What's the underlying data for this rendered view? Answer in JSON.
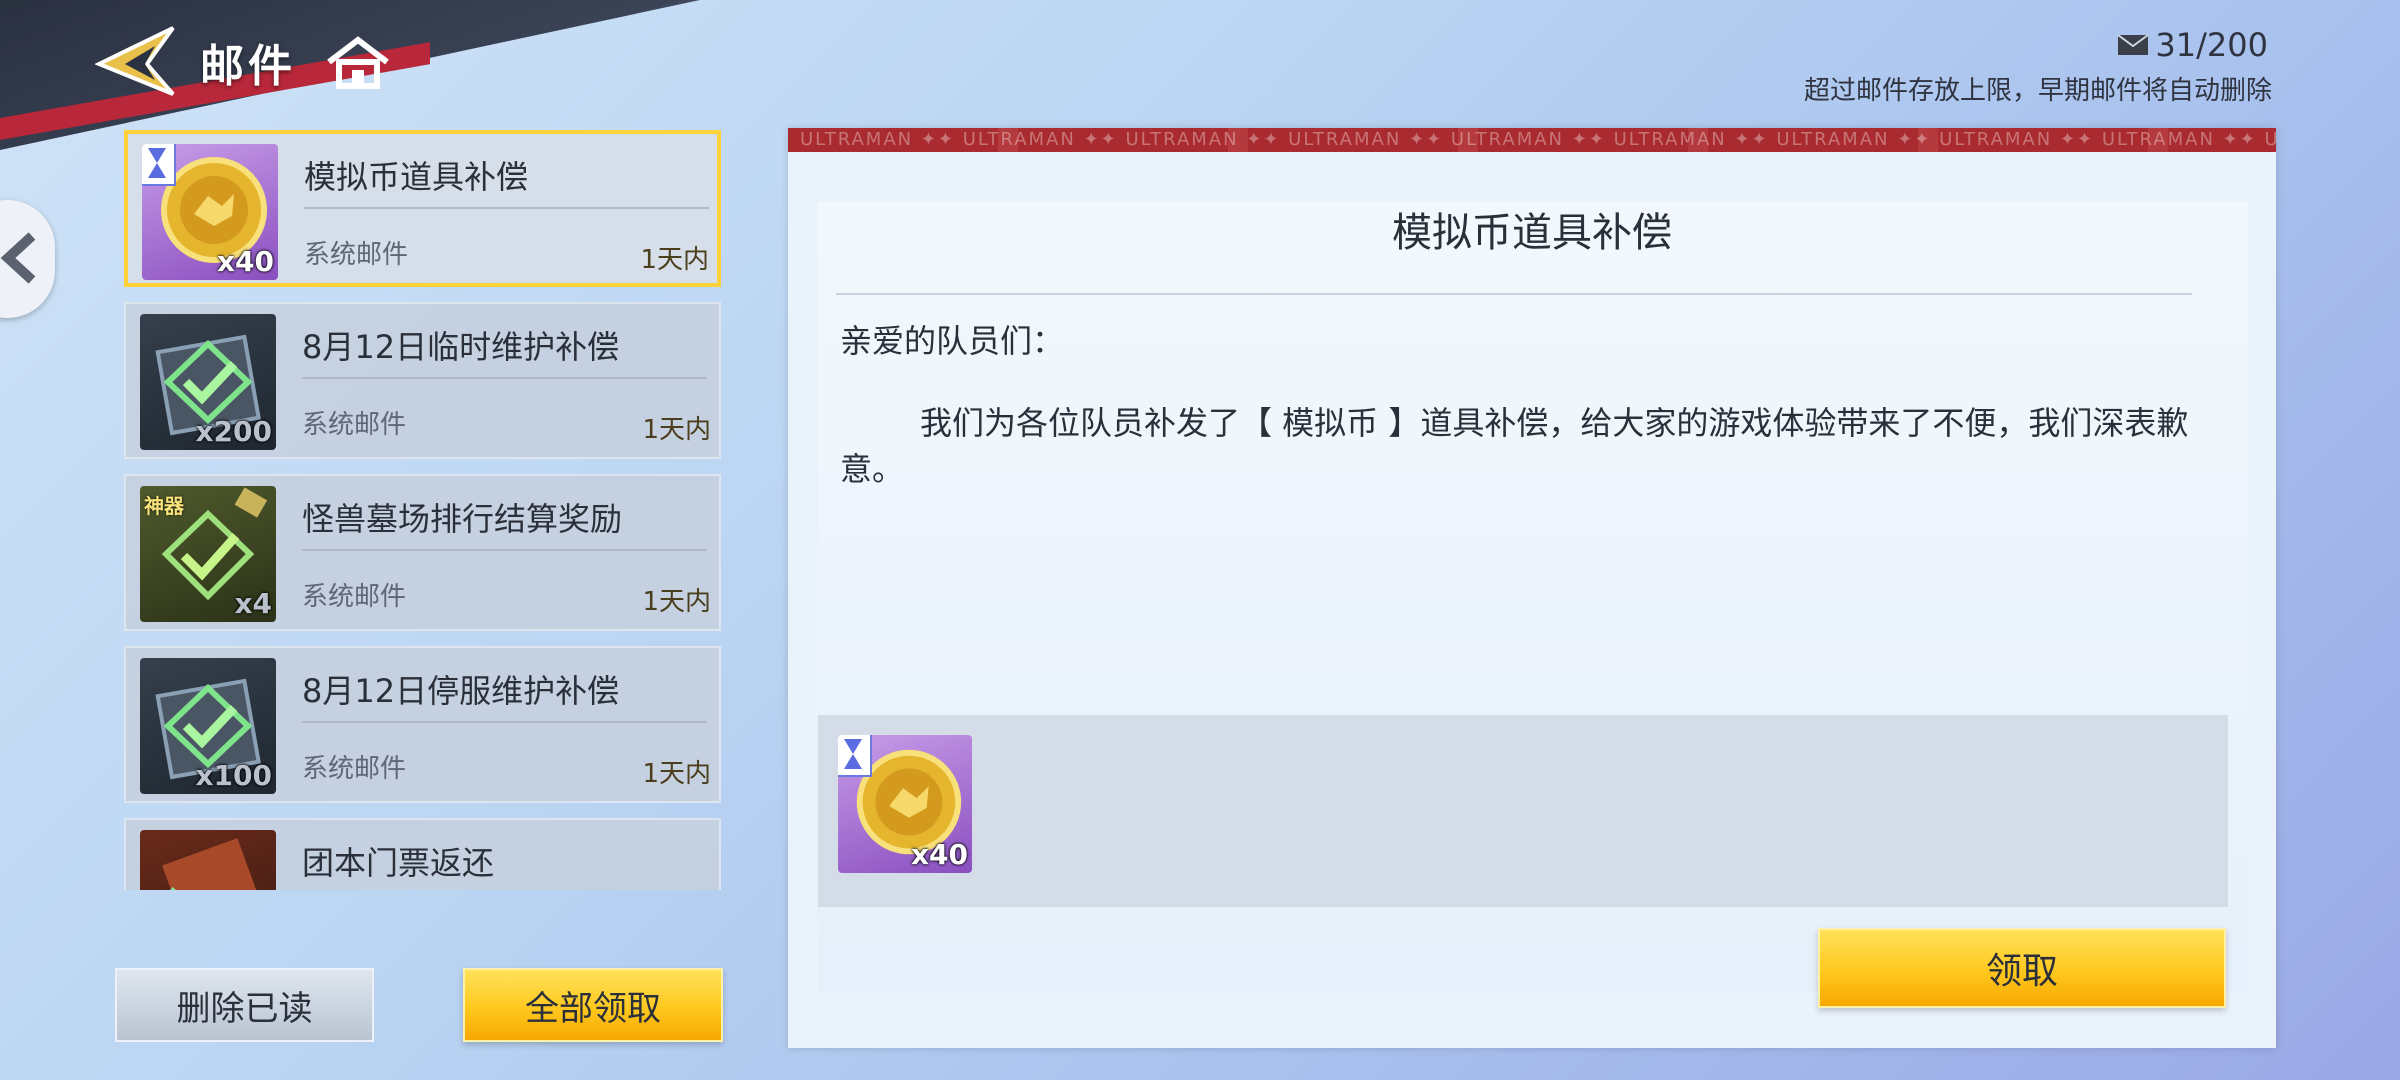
{
  "header": {
    "title": "邮件",
    "home_icon": "home-icon",
    "logo_icon": "star-shuriken-logo"
  },
  "mailbox": {
    "count": "31/200",
    "notice": "超过邮件存放上限，早期邮件将自动删除",
    "icon": "envelope-icon"
  },
  "mails": [
    {
      "title": "模拟币道具补偿",
      "sender": "系统邮件",
      "expire": "1天内",
      "qty": "x40",
      "icon": "gold-coin-icon",
      "selected": true
    },
    {
      "title": "8月12日临时维护补偿",
      "sender": "系统邮件",
      "expire": "1天内",
      "qty": "x200",
      "icon": "check-box-icon"
    },
    {
      "title": "怪兽墓场排行结算奖励",
      "sender": "系统邮件",
      "expire": "1天内",
      "qty": "x4",
      "icon": "artifact-check-icon",
      "badge": "神器"
    },
    {
      "title": "8月12日停服维护补偿",
      "sender": "系统邮件",
      "expire": "1天内",
      "qty": "x100",
      "icon": "check-box-icon"
    },
    {
      "title": "团本门票返还",
      "sender": "",
      "expire": "",
      "qty": "",
      "icon": "ticket-icon"
    }
  ],
  "buttons": {
    "delete_read": "删除已读",
    "claim_all": "全部领取",
    "claim": "领取"
  },
  "detail": {
    "banner_text": "ULTRAMAN",
    "title": "模拟币道具补偿",
    "greeting": "亲爱的队员们：",
    "body": "我们为各位队员补发了【 模拟币 】道具补偿，给大家的游戏体验带来了不便，我们深表歉意。",
    "attachment": {
      "qty": "x40",
      "icon": "gold-coin-icon"
    }
  },
  "colors": {
    "accent_yellow": "#ffc81e",
    "banner_red": "#a92a2f",
    "selected_border": "#ffd23a"
  }
}
